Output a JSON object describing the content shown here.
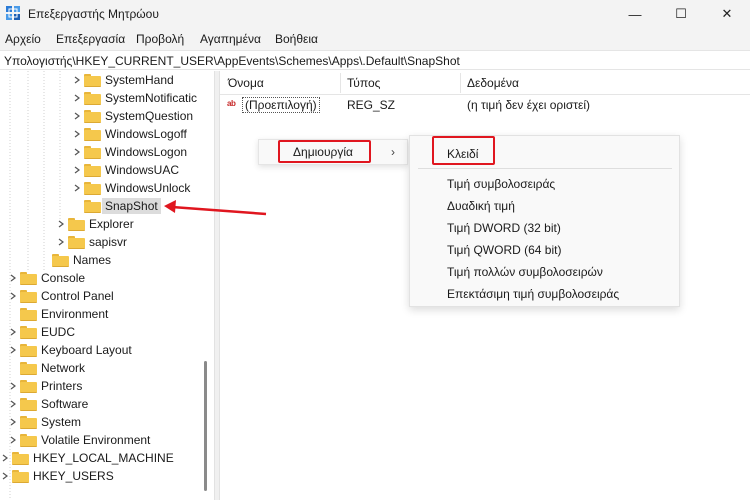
{
  "window": {
    "title": "Επεξεργαστής Μητρώου",
    "minimize_glyph": "—",
    "maximize_glyph": "☐",
    "close_glyph": "✕"
  },
  "menu": {
    "file": "Αρχείο",
    "edit": "Επεξεργασία",
    "view": "Προβολή",
    "favorites": "Αγαπημένα",
    "help": "Βοήθεια"
  },
  "address": {
    "path": "Υπολογιστής\\HKEY_CURRENT_USER\\AppEvents\\Schemes\\Apps\\.Default\\SnapShot"
  },
  "tree": {
    "items": [
      {
        "label": "SystemHand",
        "expandable": true
      },
      {
        "label": "SystemNotificatic",
        "expandable": true
      },
      {
        "label": "SystemQuestion",
        "expandable": true
      },
      {
        "label": "WindowsLogoff",
        "expandable": true
      },
      {
        "label": "WindowsLogon",
        "expandable": true
      },
      {
        "label": "WindowsUAC",
        "expandable": true
      },
      {
        "label": "WindowsUnlock",
        "expandable": true
      },
      {
        "label": "SnapShot",
        "expandable": false,
        "selected": true
      },
      {
        "label": "Explorer",
        "expandable": true
      },
      {
        "label": "sapisvr",
        "expandable": true
      },
      {
        "label": "Names",
        "expandable": false
      },
      {
        "label": "Console",
        "expandable": true
      },
      {
        "label": "Control Panel",
        "expandable": true
      },
      {
        "label": "Environment",
        "expandable": false
      },
      {
        "label": "EUDC",
        "expandable": true
      },
      {
        "label": "Keyboard Layout",
        "expandable": true
      },
      {
        "label": "Network",
        "expandable": false
      },
      {
        "label": "Printers",
        "expandable": true
      },
      {
        "label": "Software",
        "expandable": true
      },
      {
        "label": "System",
        "expandable": true
      },
      {
        "label": "Volatile Environment",
        "expandable": true
      },
      {
        "label": "HKEY_LOCAL_MACHINE",
        "expandable": true
      },
      {
        "label": "HKEY_USERS",
        "expandable": true
      }
    ]
  },
  "list": {
    "columns": [
      "Όνομα",
      "Τύπος",
      "Δεδομένα"
    ],
    "rows": [
      {
        "icon_text": "ab",
        "name": "(Προεπιλογή)",
        "type": "REG_SZ",
        "data": "(η τιμή δεν έχει οριστεί)"
      }
    ]
  },
  "context_menu": {
    "new_label": "Δημιουργία",
    "arrow": "›"
  },
  "submenu": {
    "key": "Κλειδί",
    "items": [
      "Τιμή συμβολοσειράς",
      "Δυαδική τιμή",
      "Τιμή DWORD (32 bit)",
      "Τιμή QWORD (64 bit)",
      "Τιμή πολλών συμβολοσειρών",
      "Επεκτάσιμη τιμή συμβολοσειράς"
    ]
  },
  "annotation_color": "#e0161f",
  "icons": {
    "app": "registry-editor-icon",
    "folder": "folder-icon",
    "chevron": "chevron-right-icon",
    "string_value": "string-value-icon"
  }
}
